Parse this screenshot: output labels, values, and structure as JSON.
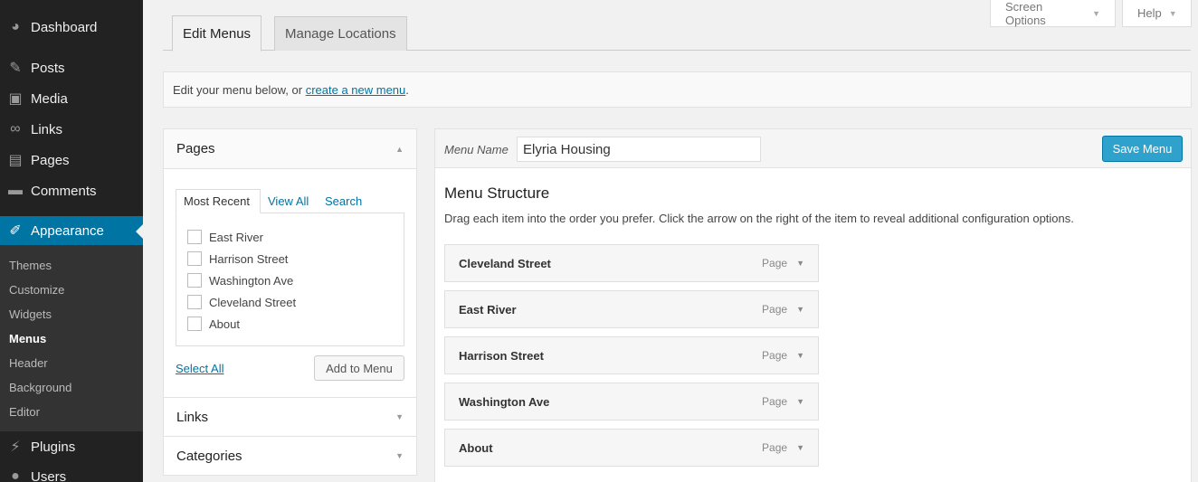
{
  "sidebar": {
    "dashboard": "Dashboard",
    "posts": "Posts",
    "media": "Media",
    "links": "Links",
    "pages": "Pages",
    "comments": "Comments",
    "appearance": "Appearance",
    "submenu": [
      "Themes",
      "Customize",
      "Widgets",
      "Menus",
      "Header",
      "Background",
      "Editor"
    ],
    "plugins": "Plugins",
    "users": "Users"
  },
  "top_buttons": {
    "screen_options": "Screen Options",
    "help": "Help"
  },
  "tabs": {
    "edit_menus": "Edit Menus",
    "manage_locations": "Manage Locations"
  },
  "notice": {
    "prefix": "Edit your menu below, or ",
    "link": "create a new menu",
    "suffix": "."
  },
  "left_panel": {
    "pages_title": "Pages",
    "inner_tabs": {
      "recent": "Most Recent",
      "view_all": "View All",
      "search": "Search"
    },
    "pages": [
      "East River",
      "Harrison Street",
      "Washington Ave",
      "Cleveland Street",
      "About"
    ],
    "select_all": "Select All",
    "add_to_menu": "Add to Menu",
    "links_title": "Links",
    "categories_title": "Categories"
  },
  "menu": {
    "name_label": "Menu Name",
    "name_value": "Elyria Housing",
    "save": "Save Menu",
    "structure_title": "Menu Structure",
    "structure_desc": "Drag each item into the order you prefer. Click the arrow on the right of the item to reveal additional configuration options.",
    "items": [
      {
        "title": "Cleveland Street",
        "type": "Page"
      },
      {
        "title": "East River",
        "type": "Page"
      },
      {
        "title": "Harrison Street",
        "type": "Page"
      },
      {
        "title": "Washington Ave",
        "type": "Page"
      },
      {
        "title": "About",
        "type": "Page"
      }
    ]
  },
  "colors": {
    "accent": "#0074a2",
    "button_primary": "#2ea2cc",
    "sidebar": "#222222"
  }
}
